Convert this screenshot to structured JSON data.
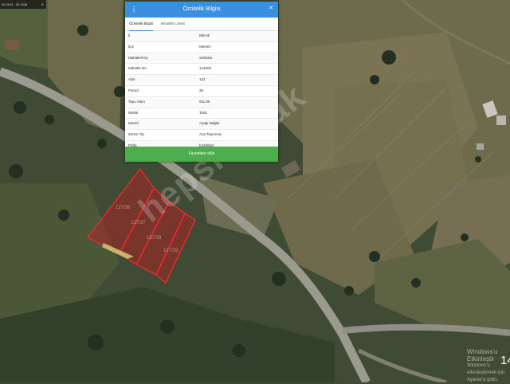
{
  "map": {
    "coordinate_readout": "40.2914 : 30.1428",
    "parcel_labels": [
      "127/36",
      "127/37",
      "127/38",
      "127/39"
    ],
    "watermark": "hepsiemlak",
    "windows_notice": {
      "title": "Windows'u Etkinleştir",
      "subtitle": "Windows'u etkinleştirmek için Ayarlar'a gidin."
    },
    "clock_digits": "14",
    "parcel_color": "#c01822"
  },
  "panel": {
    "title": "Öznitelik Bilgisi",
    "menu_icon": "kebab-menu-icon",
    "close_icon": "close-icon",
    "close_glyph": "✕",
    "accent": "#3b8fe0",
    "tabs": [
      {
        "label": "Öznitelik Bilgisi"
      },
      {
        "label": "Bina/BB Listesi"
      }
    ],
    "rows": [
      {
        "key": "İl",
        "value": "Bilecik"
      },
      {
        "key": "İlçe",
        "value": "Merkez"
      },
      {
        "key": "Mahalle/Köy",
        "value": "Selbükü"
      },
      {
        "key": "Mahalle No",
        "value": "124609"
      },
      {
        "key": "Ada",
        "value": "122"
      },
      {
        "key": "Parsel",
        "value": "38"
      },
      {
        "key": "Tapu Alanı",
        "value": "911.95"
      },
      {
        "key": "Nitelik",
        "value": "Tarla"
      },
      {
        "key": "Mevkii",
        "value": "Aşağı Bağlar"
      },
      {
        "key": "Zemin Tip",
        "value": "Ana Taşınmaz"
      },
      {
        "key": "Pafta",
        "value": "h24d5la2"
      }
    ],
    "button_label": "Favorilere ekle",
    "button_color": "#4cae4c"
  }
}
